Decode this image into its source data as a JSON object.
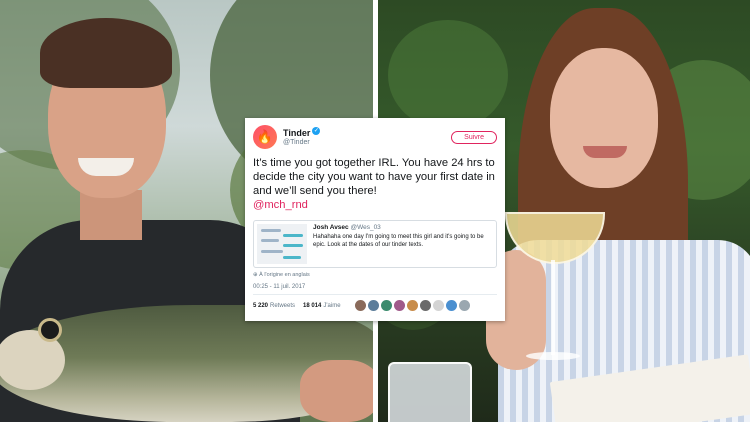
{
  "tweet": {
    "avatar_glyph": "🔥",
    "author_name": "Tinder",
    "author_handle": "@Tinder",
    "follow_label": "Suivre",
    "text": "It’s time you got together IRL. You have 24 hrs to decide the city you want to have your first date in and we’ll send you there!",
    "mention": "@mch_rnd",
    "quoted": {
      "name": "Josh Avsec",
      "handle": "@Wes_03",
      "text": "Hahahaha one day I'm going to meet this girl and it's going to be epic. Look at the dates of our tinder texts."
    },
    "translate_label": "À l'origine en anglais",
    "timestamp": "00:25 - 11 juil. 2017",
    "retweets_count": "5 220",
    "retweets_label": "Retweets",
    "likes_count": "18 014",
    "likes_label": "J'aime"
  },
  "colors": {
    "brand": "#fd5068",
    "follow": "#e0245e",
    "verified": "#1da1f2"
  }
}
